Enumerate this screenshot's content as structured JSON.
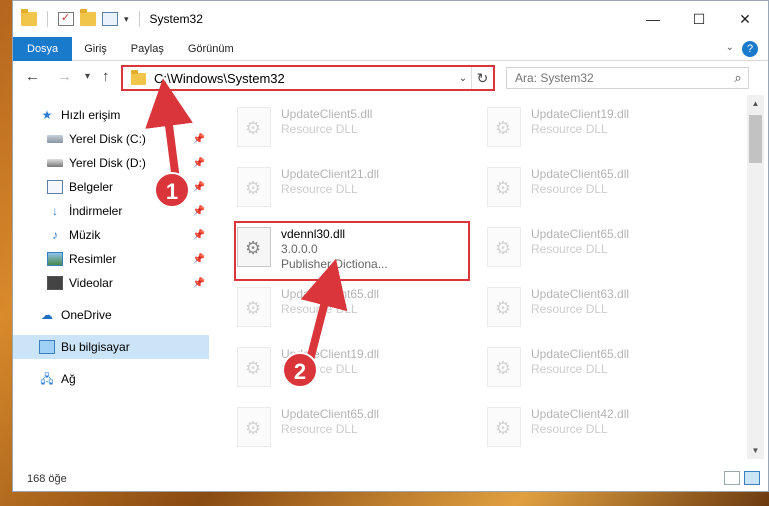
{
  "window": {
    "title": "System32",
    "minimize_glyph": "—",
    "maximize_glyph": "☐",
    "close_glyph": "✕"
  },
  "ribbon": {
    "tabs": [
      "Dosya",
      "Giriş",
      "Paylaş",
      "Görünüm"
    ],
    "help_glyph": "?"
  },
  "navigation": {
    "address": "C:\\Windows\\System32",
    "search_placeholder": "Ara: System32"
  },
  "sidebar": {
    "items": [
      {
        "label": "Hızlı erişim",
        "icon": "star-icon",
        "pinned": false
      },
      {
        "label": "Yerel Disk (C:)",
        "icon": "drive-icon",
        "pinned": true
      },
      {
        "label": "Yerel Disk (D:)",
        "icon": "drive-icon",
        "pinned": true
      },
      {
        "label": "Belgeler",
        "icon": "documents-icon",
        "pinned": true
      },
      {
        "label": "İndirmeler",
        "icon": "download-icon",
        "pinned": true
      },
      {
        "label": "Müzik",
        "icon": "music-icon",
        "pinned": true
      },
      {
        "label": "Resimler",
        "icon": "pictures-icon",
        "pinned": true
      },
      {
        "label": "Videolar",
        "icon": "videos-icon",
        "pinned": true
      },
      {
        "label": "OneDrive",
        "icon": "cloud-icon",
        "pinned": false
      },
      {
        "label": "Bu bilgisayar",
        "icon": "computer-icon",
        "pinned": false,
        "selected": true
      },
      {
        "label": "Ağ",
        "icon": "network-icon",
        "pinned": false
      }
    ]
  },
  "files": [
    {
      "name": "UpdateClient5.dll",
      "desc": "Resource DLL"
    },
    {
      "name": "UpdateClient19.dll",
      "desc": "Resource DLL"
    },
    {
      "name": "UpdateClient21.dll",
      "desc": "Resource DLL"
    },
    {
      "name": "UpdateClient65.dll",
      "desc": "Resource DLL"
    },
    {
      "name": "vdennl30.dll",
      "version": "3.0.0.0",
      "desc": "Publisher Dictiona...",
      "highlighted": true
    },
    {
      "name": "UpdateClient65.dll",
      "desc": "Resource DLL"
    },
    {
      "name": "UpdateClient65.dll",
      "desc": "Resource DLL"
    },
    {
      "name": "UpdateClient63.dll",
      "desc": "Resource DLL"
    },
    {
      "name": "UpdateClient19.dll",
      "desc": "Resource DLL"
    },
    {
      "name": "UpdateClient65.dll",
      "desc": "Resource DLL"
    },
    {
      "name": "UpdateClient65.dll",
      "desc": "Resource DLL"
    },
    {
      "name": "UpdateClient42.dll",
      "desc": "Resource DLL"
    }
  ],
  "status": {
    "item_count": "168 öğe"
  },
  "annotations": {
    "step1": "1",
    "step2": "2",
    "color": "#d9353a"
  }
}
